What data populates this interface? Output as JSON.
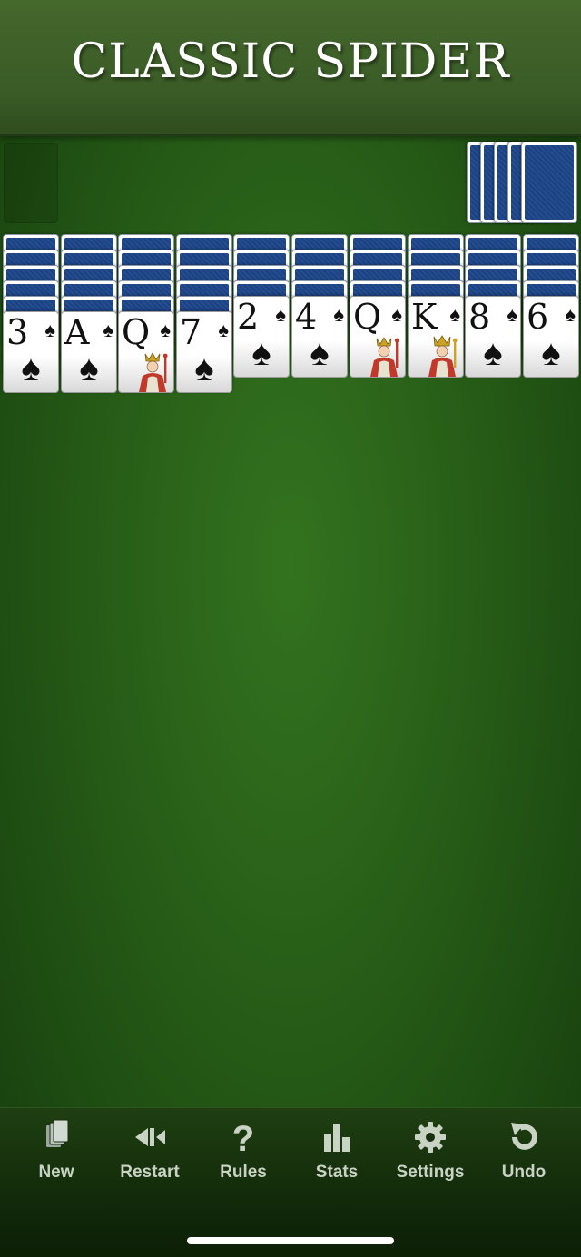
{
  "header": {
    "title": "CLASSIC SPIDER"
  },
  "theme": {
    "felt": "#2a6219",
    "header_bg": "#3a5b26",
    "card_back": "#244d90",
    "toolbar_bg": "#122a0a"
  },
  "stock": {
    "piles_remaining": 5
  },
  "tableau": [
    {
      "hidden": 5,
      "top": {
        "rank": "3",
        "suit": "♠",
        "court": false
      }
    },
    {
      "hidden": 5,
      "top": {
        "rank": "A",
        "suit": "♠",
        "court": false
      }
    },
    {
      "hidden": 5,
      "top": {
        "rank": "Q",
        "suit": "♠",
        "court": true
      }
    },
    {
      "hidden": 5,
      "top": {
        "rank": "7",
        "suit": "♠",
        "court": false
      }
    },
    {
      "hidden": 4,
      "top": {
        "rank": "2",
        "suit": "♠",
        "court": false
      }
    },
    {
      "hidden": 4,
      "top": {
        "rank": "4",
        "suit": "♠",
        "court": false
      }
    },
    {
      "hidden": 4,
      "top": {
        "rank": "Q",
        "suit": "♠",
        "court": true
      }
    },
    {
      "hidden": 4,
      "top": {
        "rank": "K",
        "suit": "♠",
        "court": true
      }
    },
    {
      "hidden": 4,
      "top": {
        "rank": "8",
        "suit": "♠",
        "court": false
      }
    },
    {
      "hidden": 4,
      "top": {
        "rank": "6",
        "suit": "♠",
        "court": false
      }
    }
  ],
  "toolbar": {
    "items": [
      {
        "label": "New",
        "icon": "new-game-icon"
      },
      {
        "label": "Restart",
        "icon": "restart-icon"
      },
      {
        "label": "Rules",
        "icon": "help-icon"
      },
      {
        "label": "Stats",
        "icon": "stats-icon"
      },
      {
        "label": "Settings",
        "icon": "gear-icon"
      },
      {
        "label": "Undo",
        "icon": "undo-icon"
      }
    ]
  }
}
